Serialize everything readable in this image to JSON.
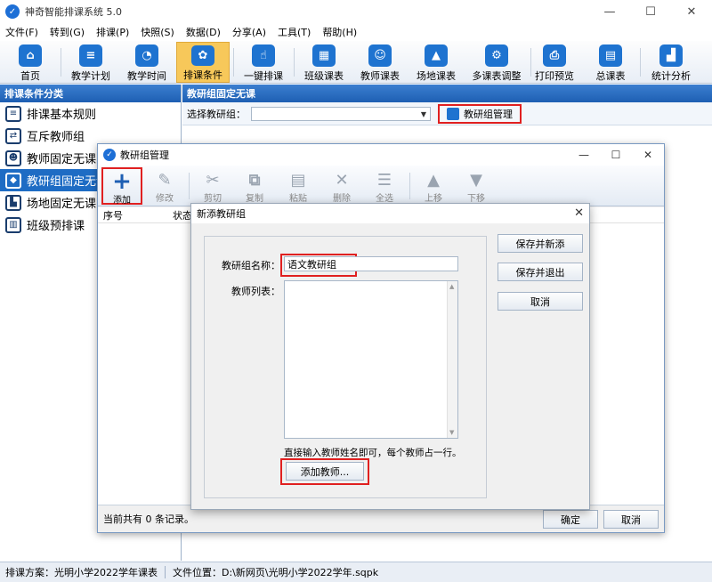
{
  "window": {
    "title": "神奇智能排课系统 5.0"
  },
  "menu": [
    "文件(F)",
    "转到(G)",
    "排课(P)",
    "快照(S)",
    "数据(D)",
    "分享(A)",
    "工具(T)",
    "帮助(H)"
  ],
  "toolbar": [
    {
      "label": "首页",
      "icon": "home-icon"
    },
    {
      "label": "教学计划",
      "icon": "clipboard-icon"
    },
    {
      "label": "教学时间",
      "icon": "clock-icon"
    },
    {
      "label": "排课条件",
      "icon": "nodes-icon",
      "active": true
    },
    {
      "label": "一键排课",
      "icon": "hand-icon"
    },
    {
      "label": "班级课表",
      "icon": "grid-icon"
    },
    {
      "label": "教师课表",
      "icon": "teacher-icon"
    },
    {
      "label": "场地课表",
      "icon": "building-icon"
    },
    {
      "label": "多课表调整",
      "icon": "adjust-icon"
    },
    {
      "label": "打印预览",
      "icon": "printer-icon"
    },
    {
      "label": "总课表",
      "icon": "calendar-icon"
    },
    {
      "label": "统计分析",
      "icon": "chart-icon"
    }
  ],
  "left_panel": {
    "title": "排课条件分类",
    "items": [
      {
        "label": "排课基本规则",
        "icon": "rules-icon"
      },
      {
        "label": "互斥教师组",
        "icon": "mutex-icon"
      },
      {
        "label": "教师固定无课",
        "icon": "person-icon"
      },
      {
        "label": "教研组固定无课",
        "icon": "cube-icon",
        "selected": true
      },
      {
        "label": "场地固定无课",
        "icon": "venue-icon"
      },
      {
        "label": "班级预排课",
        "icon": "book-icon"
      }
    ]
  },
  "right_panel": {
    "title": "教研组固定无课",
    "select_label": "选择教研组：",
    "manage_button": "教研组管理"
  },
  "statusbar": {
    "plan": "排课方案：光明小学2022学年课表",
    "file": "文件位置：D:\\新网页\\光明小学2022学年.sqpk"
  },
  "group_dialog": {
    "title": "教研组管理",
    "tools": [
      {
        "label": "添加",
        "glyph": "+"
      },
      {
        "label": "修改",
        "glyph": "✎"
      },
      {
        "label": "剪切",
        "glyph": "✂"
      },
      {
        "label": "复制",
        "glyph": "⧉"
      },
      {
        "label": "粘贴",
        "glyph": "▤"
      },
      {
        "label": "删除",
        "glyph": "✕"
      },
      {
        "label": "全选",
        "glyph": "☰"
      },
      {
        "label": "上移",
        "glyph": "▲"
      },
      {
        "label": "下移",
        "glyph": "▼"
      }
    ],
    "columns": [
      "序号",
      "状态"
    ],
    "record_count": "当前共有 0 条记录。",
    "ok": "确定",
    "cancel": "取消"
  },
  "new_group_dialog": {
    "title": "新添教研组",
    "name_label": "教研组名称：",
    "name_value": "语文教研组",
    "teacher_list_label": "教师列表：",
    "hint": "直接输入教师姓名即可，每个教师占一行。",
    "add_teacher": "添加教师...",
    "save_new": "保存并新添",
    "save_exit": "保存并退出",
    "cancel": "取消"
  }
}
